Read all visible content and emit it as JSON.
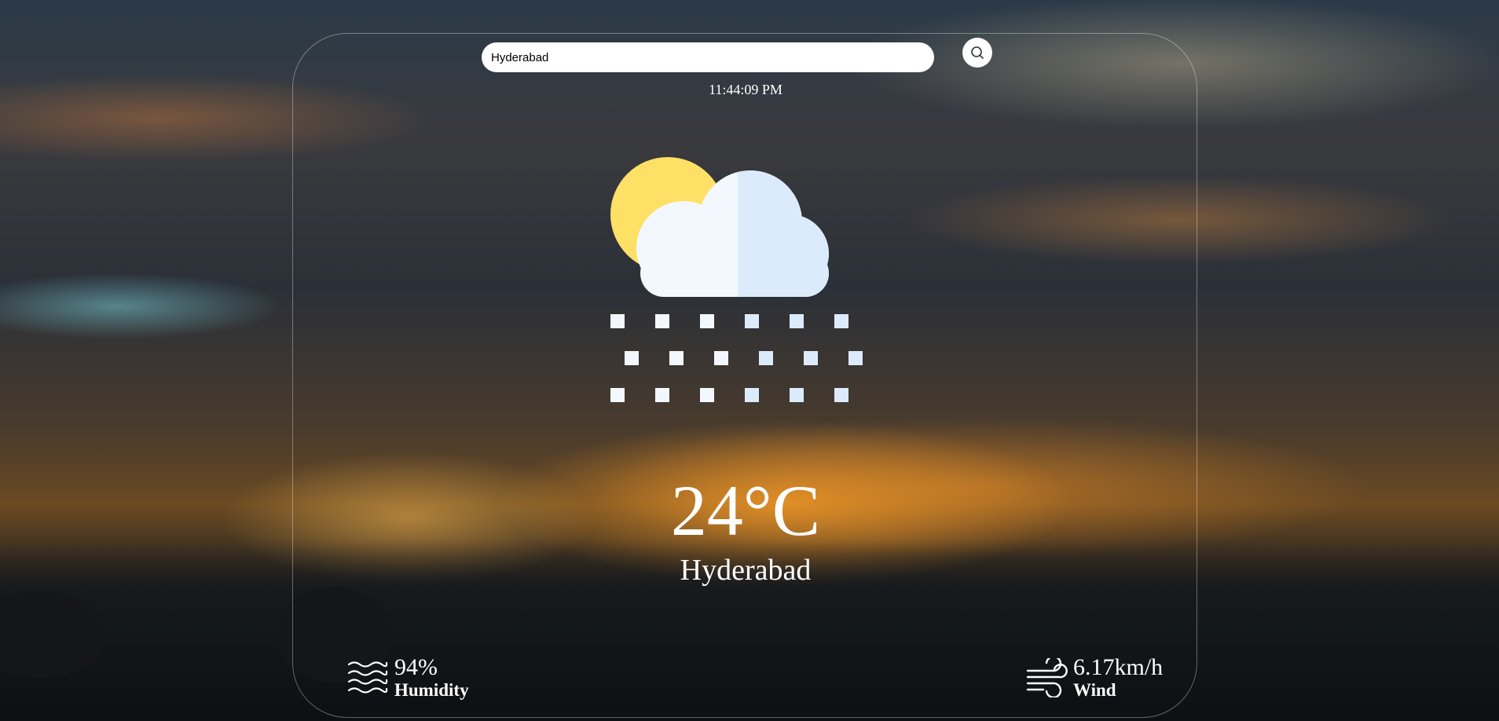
{
  "search": {
    "value": "Hyderabad",
    "button_icon": "search-icon"
  },
  "time": "11:44:09 PM",
  "weather": {
    "icon": "sun-cloud-snow-icon",
    "temperature": "24°C",
    "city": "Hyderabad"
  },
  "humidity": {
    "value": "94%",
    "label": "Humidity",
    "icon": "humidity-waves-icon"
  },
  "wind": {
    "value": "6.17km/h",
    "label": "Wind",
    "icon": "wind-icon"
  },
  "colors": {
    "sun": "#FFE066",
    "cloud_light": "#F3F8FE",
    "cloud_shade": "#DCEBFC",
    "text": "#FFFFFF"
  }
}
